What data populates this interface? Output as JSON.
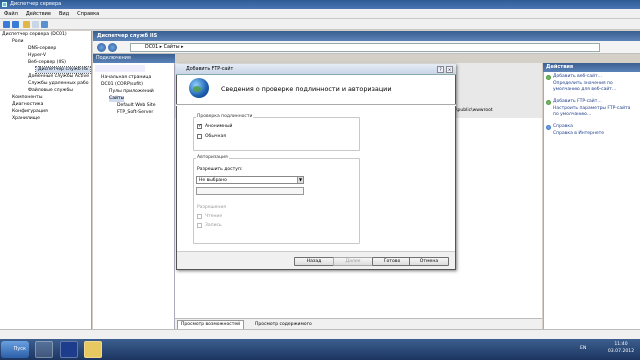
{
  "window": {
    "title": "Диспетчер сервера"
  },
  "menu": [
    "Файл",
    "Действие",
    "Вид",
    "Справка"
  ],
  "tree": {
    "items": [
      {
        "label": "Диспетчер сервера (DC01)",
        "level": 0
      },
      {
        "label": "Роли",
        "level": 1
      },
      {
        "label": "DNS-сервер",
        "level": 2
      },
      {
        "label": "Hyper-V",
        "level": 2
      },
      {
        "label": "Веб-сервер (IIS)",
        "level": 2
      },
      {
        "label": "Диспетчер служб IIS",
        "level": 3
      },
      {
        "label": "Доменные службы Active",
        "level": 2
      },
      {
        "label": "Службы удаленных рабо",
        "level": 2
      },
      {
        "label": "Файловые службы",
        "level": 2
      },
      {
        "label": "Компоненты",
        "level": 1
      },
      {
        "label": "Диагностика",
        "level": 1
      },
      {
        "label": "Конфигурация",
        "level": 1
      },
      {
        "label": "Хранилище",
        "level": 1
      }
    ]
  },
  "iis": {
    "header": "Диспетчер служб IIS",
    "address": "DC01  ▸  Сайты  ▸"
  },
  "connections": {
    "header": "Подключения",
    "items": [
      {
        "label": "Начальная страница",
        "level": 0
      },
      {
        "label": "DC01 (CORP\\sofit)",
        "level": 0
      },
      {
        "label": "Пулы приложений",
        "level": 1
      },
      {
        "label": "Сайты",
        "level": 1
      },
      {
        "label": "Default Web Site",
        "level": 2
      },
      {
        "label": "FTP_Soft-Server",
        "level": 2
      }
    ]
  },
  "center": {
    "path": "\\public\\wwwroot"
  },
  "bottom_tabs": {
    "features": "Просмотр возможностей",
    "content": "Просмотр содержимого"
  },
  "actions": {
    "header": "Действия",
    "items": [
      {
        "label": "Добавить веб-сайт..."
      },
      {
        "label": "Определить значения по умолчанию для веб-сайт..."
      },
      {
        "label": "Добавить FTP-сайт..."
      },
      {
        "label": "Настроить параметры FTP-сайта по умолчанию..."
      },
      {
        "label": "Справка"
      },
      {
        "label": "Справка в Интернете"
      }
    ]
  },
  "dialog": {
    "title": "Добавить FTP-сайт",
    "heading": "Сведения о проверке подлинности и авторизации",
    "auth": {
      "legend": "Проверка подлинности",
      "anonymous_label": "Анонимный",
      "anonymous_checked": true,
      "basic_label": "Обычная",
      "basic_checked": false
    },
    "authz": {
      "legend": "Авторизация",
      "allow_label": "Разрешить доступ:",
      "allow_value": "Не выбрано",
      "perm_legend": "Разрешения",
      "read_label": "Чтение",
      "write_label": "Запись"
    },
    "buttons": {
      "back": "Назад",
      "next": "Далее",
      "finish": "Готово",
      "cancel": "Отмена"
    }
  },
  "taskbar": {
    "start": "Пуск",
    "lang": "EN",
    "time": "11:40",
    "date": "03.07.2012"
  }
}
